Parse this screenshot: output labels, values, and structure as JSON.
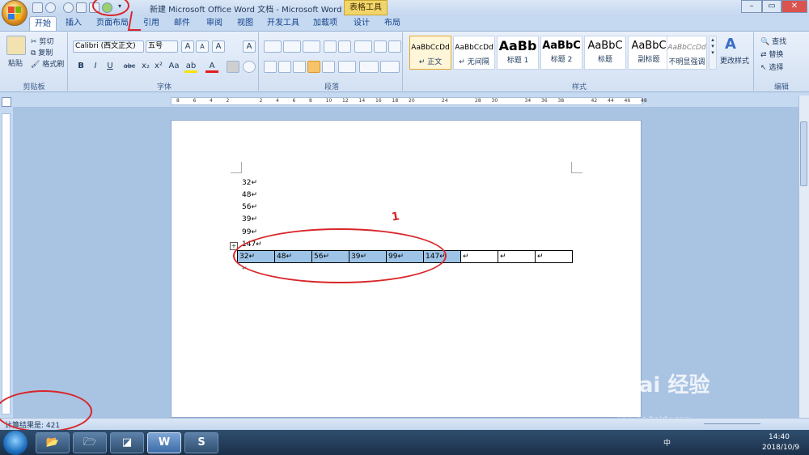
{
  "titlebar": {
    "title": "新建 Microsoft Office Word 文档 - Microsoft Word",
    "context_tab": "表格工具",
    "win_controls": [
      "–",
      "▭",
      "✕"
    ]
  },
  "tabs": [
    "开始",
    "插入",
    "页面布局",
    "引用",
    "邮件",
    "审阅",
    "视图",
    "开发工具",
    "加载项",
    "设计",
    "布局"
  ],
  "ribbon": {
    "clipboard": {
      "paste": "粘贴",
      "cut": "剪切",
      "copy": "复制",
      "format_painter": "格式刷",
      "label": "剪贴板"
    },
    "font": {
      "name": "Calibri (西文正文)",
      "size": "五号",
      "label": "字体",
      "grow": "A",
      "shrink": "A",
      "aa": "Aa",
      "bold": "B",
      "italic": "I",
      "underline": "U",
      "strike": "abc",
      "sub": "x₂",
      "sup": "x²",
      "highlight": "ab",
      "color": "A",
      "clear": "A",
      "border": "A"
    },
    "paragraph": {
      "label": "段落"
    },
    "styles": {
      "label": "样式",
      "items": [
        {
          "preview": "AaBbCcDd",
          "name": "↵ 正文"
        },
        {
          "preview": "AaBbCcDd",
          "name": "↵ 无间隔"
        },
        {
          "preview": "AaBb",
          "name": "标题 1"
        },
        {
          "preview": "AaBbC",
          "name": "标题 2"
        },
        {
          "preview": "AaBbC",
          "name": "标题"
        },
        {
          "preview": "AaBbC",
          "name": "副标题"
        },
        {
          "preview": "AaBbCcDd",
          "name": "不明显强调"
        }
      ],
      "change_styles": "更改样式"
    },
    "editing": {
      "find": "查找",
      "replace": "替换",
      "select": "选择",
      "label": "编辑"
    }
  },
  "ruler_ticks": [
    "8",
    "6",
    "4",
    "2",
    "",
    "2",
    "4",
    "6",
    "8",
    "10",
    "12",
    "14",
    "16",
    "18",
    "20",
    "",
    "24",
    "",
    "28",
    "30",
    "",
    "34",
    "36",
    "38",
    "",
    "42",
    "44",
    "46",
    "48"
  ],
  "document": {
    "lines": [
      "32↵",
      "48↵",
      "56↵",
      "39↵",
      "99↵",
      "147↵"
    ],
    "table_cells": [
      "32↵",
      "48↵",
      "56↵",
      "39↵",
      "99↵",
      "147↵",
      "↵",
      "↵",
      "↵"
    ],
    "after_table": "↵",
    "annotation_number": "1"
  },
  "status": {
    "text": "计算结果是: 421"
  },
  "taskbar": {
    "time": "14:40",
    "date": "2018/10/9",
    "ime": "中",
    "apps": [
      "📂",
      "🗁",
      "◪",
      "W",
      "S"
    ]
  },
  "watermark": {
    "brand": "Bai 经验",
    "url": "jingyan.baidu.com"
  }
}
